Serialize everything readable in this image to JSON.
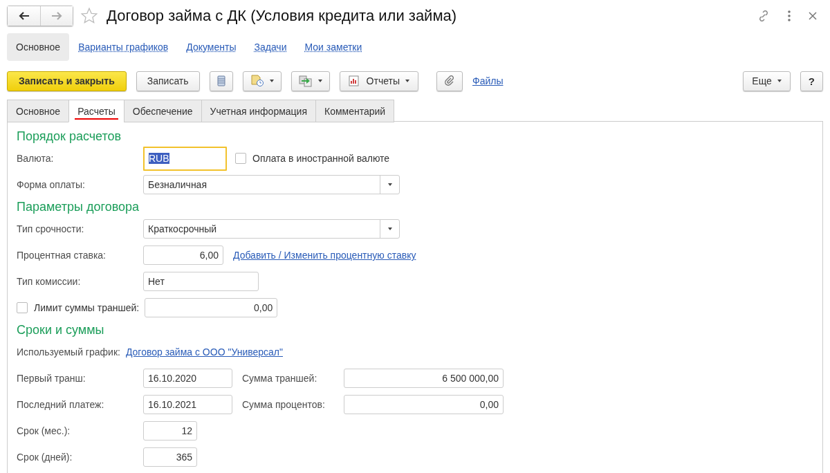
{
  "window": {
    "title": "Договор займа с ДК (Условия кредита или займа)",
    "back_disabled": false,
    "forward_disabled": true
  },
  "nav_links": [
    {
      "label": "Основное",
      "selected": true
    },
    {
      "label": "Варианты графиков",
      "selected": false
    },
    {
      "label": "Документы",
      "selected": false
    },
    {
      "label": "Задачи",
      "selected": false
    },
    {
      "label": "Мои заметки",
      "selected": false
    }
  ],
  "toolbar": [
    {
      "kind": "primary",
      "label": "Записать и закрыть"
    },
    {
      "kind": "plain",
      "label": "Записать"
    },
    {
      "kind": "list"
    },
    {
      "kind": "schedule"
    },
    {
      "kind": "exchange"
    },
    {
      "kind": "reports",
      "label": "Отчеты"
    },
    {
      "kind": "attach"
    },
    {
      "kind": "link",
      "label": "Файлы"
    },
    {
      "kind": "more",
      "label": "Еще"
    },
    {
      "kind": "help",
      "label": "?"
    }
  ],
  "tabs": [
    {
      "label": "Основное",
      "selected": false
    },
    {
      "label": "Расчеты",
      "selected": true
    },
    {
      "label": "Обеспечение",
      "selected": false
    },
    {
      "label": "Учетная информация",
      "selected": false
    },
    {
      "label": "Комментарий",
      "selected": false
    }
  ],
  "sections": [
    {
      "title": "Порядок расчетов",
      "rows": [
        {
          "items": [
            {
              "kind": "label",
              "text": "Валюта:"
            },
            {
              "kind": "code",
              "value": "RUB",
              "focused": true
            },
            {
              "kind": "checkbox",
              "label": "Оплата в иностранной валюте",
              "checked": false
            }
          ]
        },
        {
          "items": [
            {
              "kind": "label",
              "text": "Форма оплаты:"
            },
            {
              "kind": "select",
              "value": "Безналичная"
            }
          ]
        }
      ]
    },
    {
      "title": "Параметры договора",
      "rows": [
        {
          "items": [
            {
              "kind": "label",
              "text": "Тип срочности:"
            },
            {
              "kind": "select",
              "value": "Краткосрочный"
            }
          ]
        },
        {
          "items": [
            {
              "kind": "label",
              "text": "Процентная ставка:"
            },
            {
              "kind": "rate",
              "value": "6,00"
            },
            {
              "kind": "link",
              "text": "Добавить / Изменить процентную ставку"
            }
          ]
        },
        {
          "items": [
            {
              "kind": "label",
              "text": "Тип комиссии:"
            },
            {
              "kind": "text",
              "value": "Нет"
            }
          ]
        },
        {
          "items": [
            {
              "kind": "checkbox",
              "label": "Лимит суммы траншей:",
              "checked": false
            },
            {
              "kind": "limit",
              "value": "0,00"
            }
          ]
        }
      ]
    },
    {
      "title": "Сроки и суммы",
      "rows": [
        {
          "items": [
            {
              "kind": "label",
              "text": "Используемый график:"
            },
            {
              "kind": "link",
              "text": "Договор займа с ООО \"Универсал\""
            }
          ]
        },
        {
          "items": [
            {
              "kind": "label",
              "text": "Первый транш:"
            },
            {
              "kind": "date",
              "value": "16.10.2020"
            },
            {
              "kind": "label",
              "text": "Сумма траншей:"
            },
            {
              "kind": "amount",
              "value": "6 500 000,00"
            }
          ]
        },
        {
          "items": [
            {
              "kind": "label",
              "text": "Последний платеж:"
            },
            {
              "kind": "date",
              "value": "16.10.2021"
            },
            {
              "kind": "label",
              "text": "Сумма процентов:"
            },
            {
              "kind": "amount",
              "value": "0,00"
            }
          ]
        },
        {
          "items": [
            {
              "kind": "label",
              "text": "Срок (мес.):"
            },
            {
              "kind": "count",
              "value": "12"
            }
          ]
        },
        {
          "items": [
            {
              "kind": "label",
              "text": "Срок (дней):"
            },
            {
              "kind": "count",
              "value": "365"
            }
          ]
        }
      ]
    }
  ]
}
